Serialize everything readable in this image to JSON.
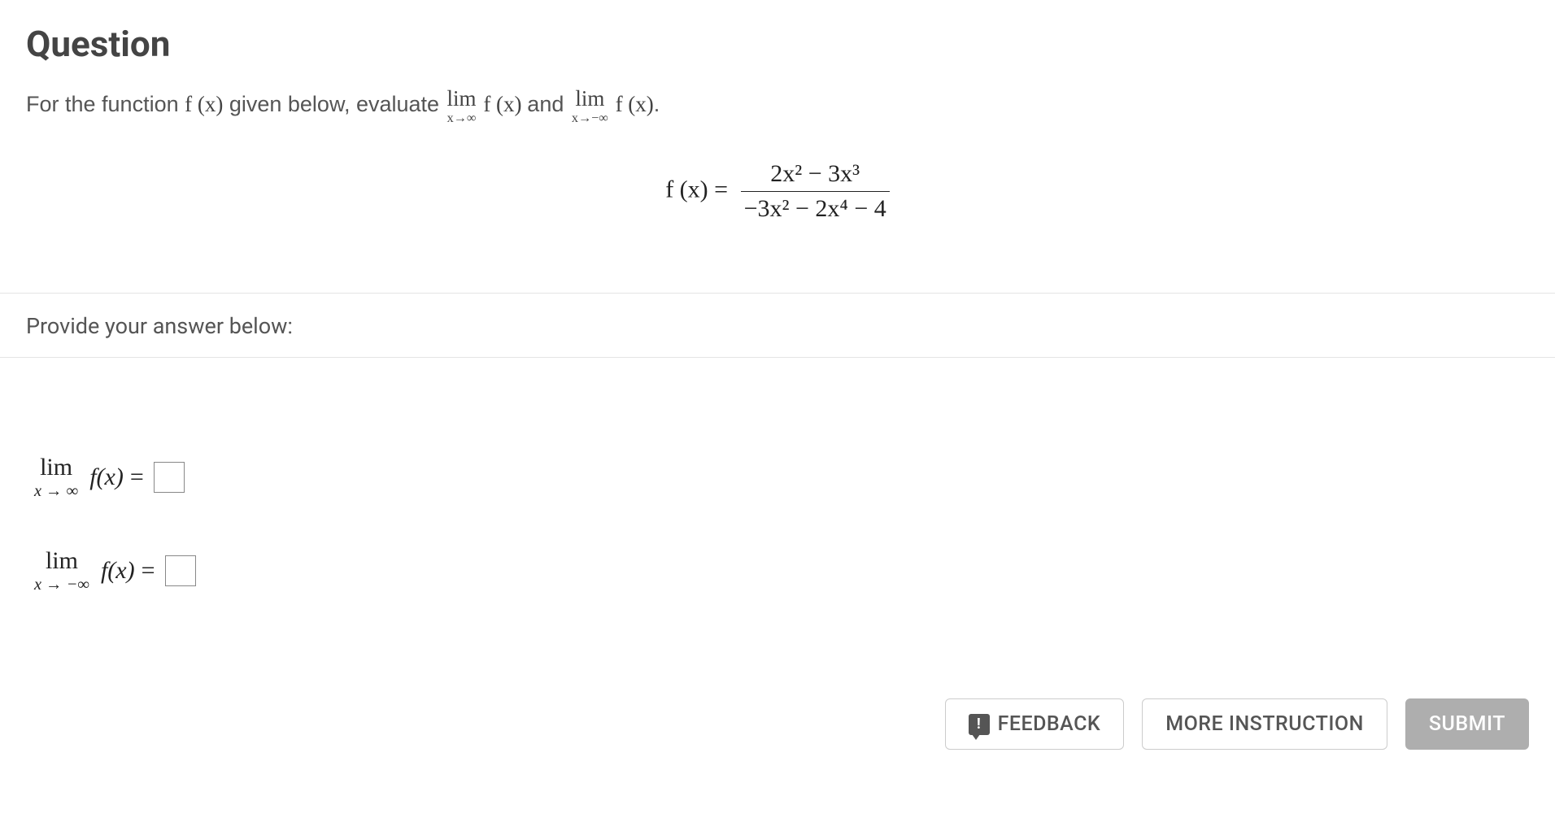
{
  "title": "Question",
  "prompt": {
    "pre": "For the function ",
    "fx": "f (x)",
    "mid1": " given below, evaluate ",
    "lim1_top": "lim",
    "lim1_bot": "x→∞",
    "mid_fx1": " f (x) ",
    "and": "and ",
    "lim2_top": "lim",
    "lim2_bot": "x→−∞",
    "mid_fx2": " f (x)",
    "end": "."
  },
  "equation": {
    "lhs": "f (x) = ",
    "num": "2x² − 3x³",
    "den": "−3x² − 2x⁴ − 4"
  },
  "answer_prompt": "Provide your answer below:",
  "answers": {
    "row1": {
      "lim_top": "lim",
      "lim_bot": "x → ∞",
      "fx": "f(x)",
      "eq": "="
    },
    "row2": {
      "lim_top": "lim",
      "lim_bot": "x → −∞",
      "fx": "f(x)",
      "eq": "="
    }
  },
  "buttons": {
    "feedback": "FEEDBACK",
    "more": "MORE INSTRUCTION",
    "submit": "SUBMIT"
  }
}
